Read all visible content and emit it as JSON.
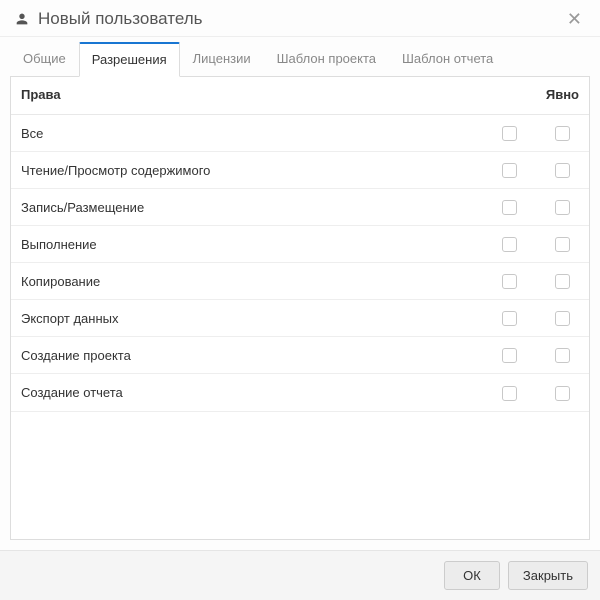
{
  "header": {
    "title": "Новый пользователь",
    "icon": "user-icon"
  },
  "tabs": [
    {
      "label": "Общие",
      "active": false
    },
    {
      "label": "Разрешения",
      "active": true
    },
    {
      "label": "Лицензии",
      "active": false
    },
    {
      "label": "Шаблон проекта",
      "active": false
    },
    {
      "label": "Шаблон отчета",
      "active": false
    }
  ],
  "permissions": {
    "columns": {
      "rights": "Права",
      "explicit": "Явно"
    },
    "rows": [
      {
        "label": "Все"
      },
      {
        "label": "Чтение/Просмотр содержимого"
      },
      {
        "label": "Запись/Размещение"
      },
      {
        "label": "Выполнение"
      },
      {
        "label": "Копирование"
      },
      {
        "label": "Экспорт данных"
      },
      {
        "label": "Создание проекта"
      },
      {
        "label": "Создание отчета"
      }
    ]
  },
  "footer": {
    "ok": "ОК",
    "close": "Закрыть"
  },
  "colors": {
    "accent": "#1976d2",
    "border": "#ddd",
    "text_muted": "#888"
  }
}
